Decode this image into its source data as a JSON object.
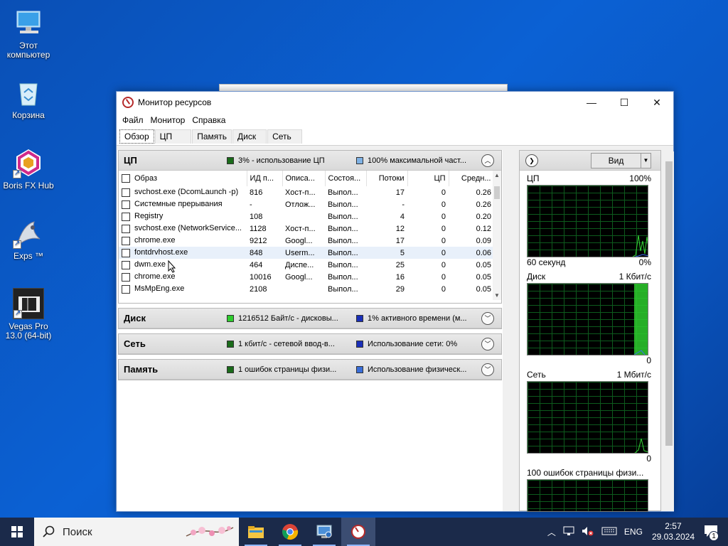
{
  "desktop": {
    "icons": [
      {
        "label": "Этот компьютер",
        "icon": "computer-icon"
      },
      {
        "label": "Корзина",
        "icon": "recycle-bin-icon"
      },
      {
        "label": "Boris FX Hub",
        "icon": "boris-fx-icon"
      },
      {
        "label": "Exps ™",
        "icon": "exps-icon"
      },
      {
        "label": "Vegas Pro 13.0 (64-bit)",
        "icon": "vegas-pro-icon"
      }
    ]
  },
  "window": {
    "title": "Монитор ресурсов",
    "menu": [
      "Файл",
      "Монитор",
      "Справка"
    ],
    "tabs": [
      "Обзор",
      "ЦП",
      "Память",
      "Диск",
      "Сеть"
    ],
    "active_tab": "Обзор"
  },
  "cpu_section": {
    "title": "ЦП",
    "indicator1": "3% - использование ЦП",
    "indicator2": "100% максимальной част...",
    "indicator1_color": "#1a6b1a",
    "indicator2_color": "#7fb2e5",
    "columns": [
      "Образ",
      "ИД п...",
      "Описа...",
      "Состоя...",
      "Потоки",
      "ЦП",
      "Средн..."
    ],
    "rows": [
      {
        "image": "svchost.exe (DcomLaunch -p)",
        "pid": "816",
        "desc": "Хост-п...",
        "state": "Выпол...",
        "threads": "17",
        "cpu": "0",
        "avg": "0.26"
      },
      {
        "image": "Системные прерывания",
        "pid": "-",
        "desc": "Отлож...",
        "state": "Выпол...",
        "threads": "-",
        "cpu": "0",
        "avg": "0.26"
      },
      {
        "image": "Registry",
        "pid": "108",
        "desc": "",
        "state": "Выпол...",
        "threads": "4",
        "cpu": "0",
        "avg": "0.20"
      },
      {
        "image": "svchost.exe (NetworkService...",
        "pid": "1128",
        "desc": "Хост-п...",
        "state": "Выпол...",
        "threads": "12",
        "cpu": "0",
        "avg": "0.12"
      },
      {
        "image": "chrome.exe",
        "pid": "9212",
        "desc": "Googl...",
        "state": "Выпол...",
        "threads": "17",
        "cpu": "0",
        "avg": "0.09"
      },
      {
        "image": "fontdrvhost.exe",
        "pid": "848",
        "desc": "Userm...",
        "state": "Выпол...",
        "threads": "5",
        "cpu": "0",
        "avg": "0.06"
      },
      {
        "image": "dwm.exe",
        "pid": "464",
        "desc": "Диспе...",
        "state": "Выпол...",
        "threads": "25",
        "cpu": "0",
        "avg": "0.05"
      },
      {
        "image": "chrome.exe",
        "pid": "10016",
        "desc": "Googl...",
        "state": "Выпол...",
        "threads": "16",
        "cpu": "0",
        "avg": "0.05"
      },
      {
        "image": "MsMpEng.exe",
        "pid": "2108",
        "desc": "",
        "state": "Выпол...",
        "threads": "29",
        "cpu": "0",
        "avg": "0.05"
      }
    ]
  },
  "disk_section": {
    "title": "Диск",
    "indicator1": "1216512 Байт/с - дисковы...",
    "indicator2": "1% активного времени (м...",
    "indicator1_color": "#2ecc2e",
    "indicator2_color": "#1a2fb8"
  },
  "net_section": {
    "title": "Сеть",
    "indicator1": "1 кбит/с - сетевой ввод-в...",
    "indicator2": "Использование сети: 0%",
    "indicator1_color": "#1a6b1a",
    "indicator2_color": "#1a2fb8"
  },
  "mem_section": {
    "title": "Память",
    "indicator1": "1 ошибок страницы физи...",
    "indicator2": "Использование физическ...",
    "indicator1_color": "#1a6b1a",
    "indicator2_color": "#3a6ed8"
  },
  "right_pane": {
    "view_label": "Вид",
    "graphs": [
      {
        "title": "ЦП",
        "max": "100%",
        "foot_left": "60 секунд",
        "foot_right": "0%"
      },
      {
        "title": "Диск",
        "max": "1 Кбит/с",
        "foot_left": "",
        "foot_right": "0"
      },
      {
        "title": "Сеть",
        "max": "1 Мбит/с",
        "foot_left": "",
        "foot_right": "0"
      },
      {
        "title": "100 ошибок страницы физи...",
        "max": "",
        "foot_left": "",
        "foot_right": ""
      }
    ]
  },
  "taskbar": {
    "search_placeholder": "Поиск",
    "apps": [
      "file-explorer-icon",
      "chrome-icon",
      "control-panel-icon",
      "resource-monitor-icon"
    ],
    "lang": "ENG",
    "time": "2:57",
    "date": "29.03.2024",
    "notification_count": "1"
  }
}
